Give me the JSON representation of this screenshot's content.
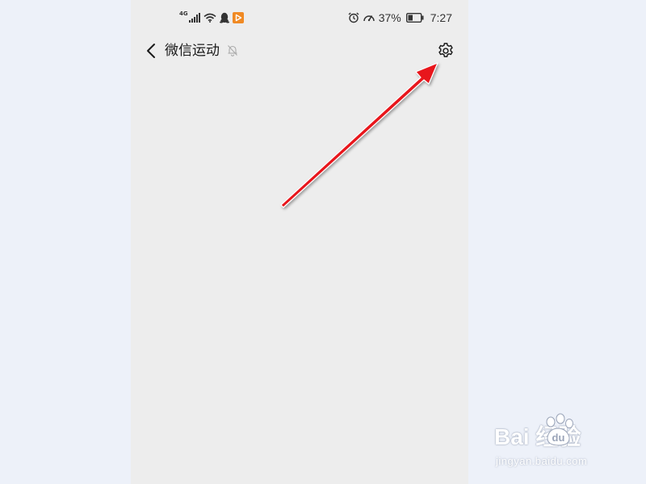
{
  "status_bar": {
    "network_type": "4G",
    "battery_percent": "37%",
    "time": "7:27",
    "icons": [
      "signal-icon",
      "wifi-icon",
      "qq-icon",
      "video-app-icon",
      "alarm-icon",
      "data-speed-icon",
      "battery-icon"
    ],
    "battery_level": 0.37
  },
  "title_bar": {
    "title": "微信运动",
    "back_icon": "chevron-left-icon",
    "mute_icon": "bell-off-icon",
    "settings_icon": "gear-icon"
  },
  "annotation": {
    "arrow_color": "#e8141a"
  },
  "colors": {
    "screen_background": "#ededed",
    "page_background": "#edf1f9",
    "text": "#1a1a1a",
    "video_app_accent": "#f08a24"
  },
  "watermark": {
    "logo_text": "Bai  经验",
    "url": "jingyan.baidu.com"
  }
}
